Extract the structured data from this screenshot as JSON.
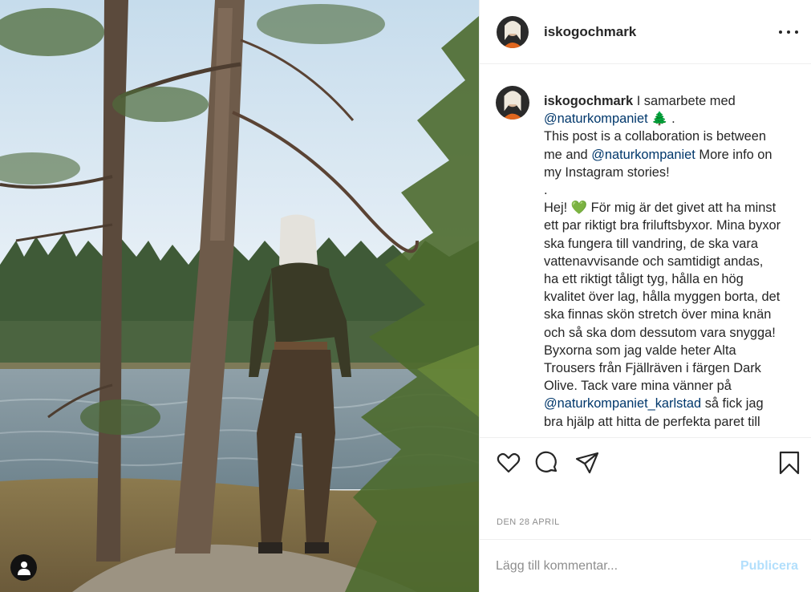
{
  "post": {
    "username": "iskogochmark",
    "more_icon": "ellipsis-icon",
    "caption": {
      "username": "iskogochmark",
      "intro": " I samarbete med",
      "mention_1": "@naturkompaniet",
      "tree_emoji": "🌲",
      "intro_end": " .",
      "line_2": "This post is a collaboration is between me and ",
      "mention_2": "@naturkompaniet",
      "line_2_end": " More info on my Instagram stories!",
      "dot": ".",
      "para_start": "Hej! ",
      "heart_emoji": "💚",
      "para_body": " För mig är det givet att ha minst ett par riktigt bra friluftsbyxor. Mina byxor ska fungera till vandring, de ska vara vattenavvisande och samtidigt andas, ha ett riktigt tåligt tyg, hålla en hög kvalitet över lag, hålla myggen borta, det ska finnas skön stretch över mina knän och så ska dom dessutom vara snygga! Byxorna som jag valde heter Alta Trousers från Fjällräven i färgen Dark Olive. Tack vare mina vänner på ",
      "mention_3": "@naturkompaniet_karlstad",
      "para_end": " så fick jag bra hjälp att hitta de perfekta paret till"
    },
    "icons": {
      "like": "heart-outline-icon",
      "comment": "comment-icon",
      "share": "paper-plane-icon",
      "save": "bookmark-icon",
      "user_tag": "user-tag-icon"
    },
    "date": "DEN 28 APRIL",
    "comment": {
      "placeholder": "Lägg till kommentar...",
      "post_label": "Publicera"
    }
  },
  "colors": {
    "mention": "#00376b",
    "post_button": "#b2dffc",
    "text": "#262626",
    "muted": "#8e8e8e"
  }
}
